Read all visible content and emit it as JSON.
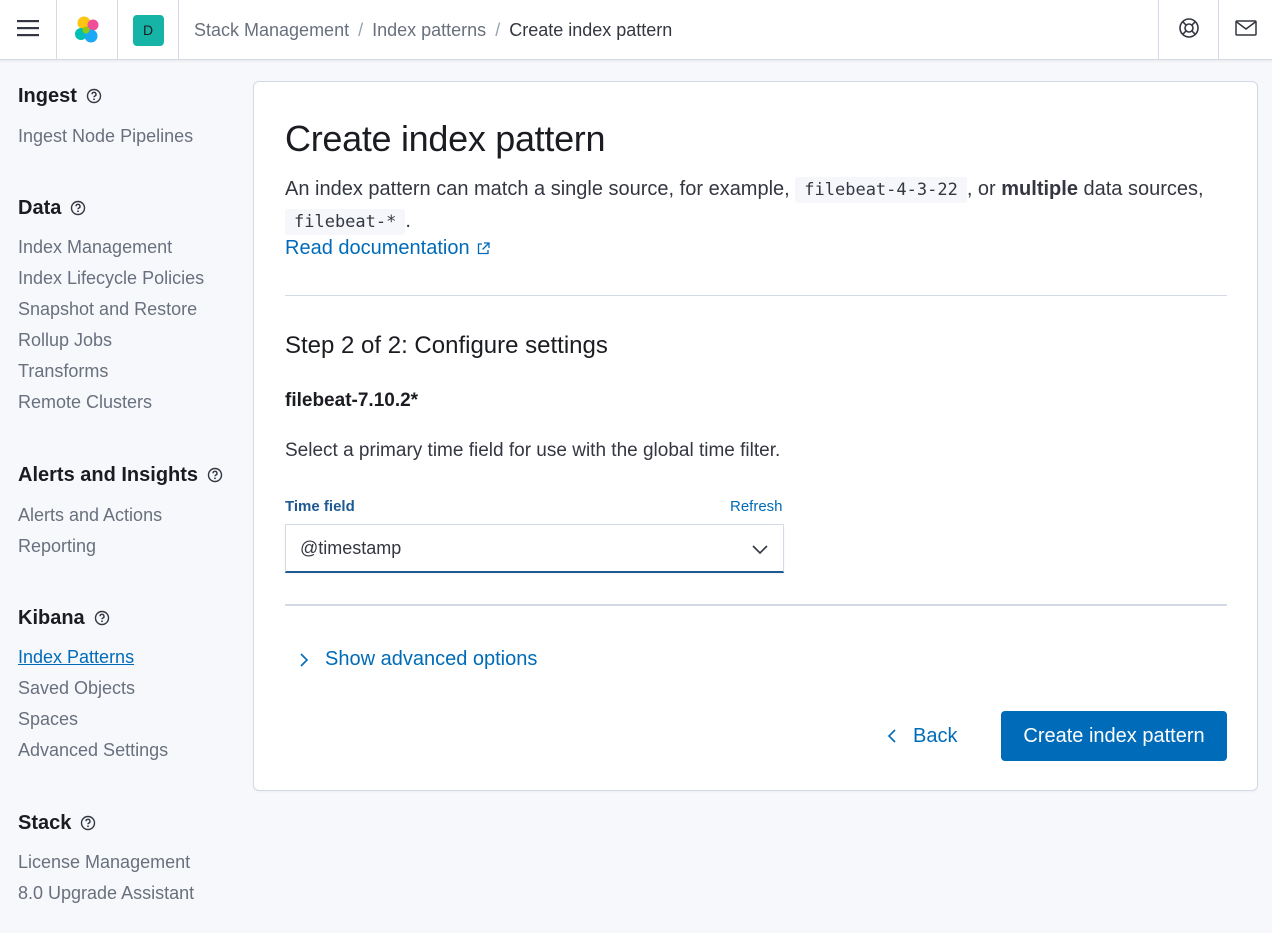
{
  "header": {
    "space_initial": "D",
    "breadcrumbs": [
      "Stack Management",
      "Index patterns",
      "Create index pattern"
    ]
  },
  "sidebar": {
    "groups": [
      {
        "title": "Ingest",
        "items": [
          "Ingest Node Pipelines"
        ]
      },
      {
        "title": "Data",
        "items": [
          "Index Management",
          "Index Lifecycle Policies",
          "Snapshot and Restore",
          "Rollup Jobs",
          "Transforms",
          "Remote Clusters"
        ]
      },
      {
        "title": "Alerts and Insights",
        "items": [
          "Alerts and Actions",
          "Reporting"
        ]
      },
      {
        "title": "Kibana",
        "items": [
          "Index Patterns",
          "Saved Objects",
          "Spaces",
          "Advanced Settings"
        ]
      },
      {
        "title": "Stack",
        "items": [
          "License Management",
          "8.0 Upgrade Assistant"
        ]
      }
    ],
    "active_item": "Index Patterns"
  },
  "main": {
    "title": "Create index pattern",
    "desc_part1": "An index pattern can match a single source, for example, ",
    "desc_code1": "filebeat-4-3-22",
    "desc_part2": ", or ",
    "desc_bold": "multiple",
    "desc_part3": " data sources, ",
    "desc_code2": "filebeat-*",
    "desc_part4": ".",
    "doc_link": "Read documentation",
    "step_title": "Step 2 of 2: Configure settings",
    "index_name": "filebeat-7.10.2*",
    "select_desc": "Select a primary time field for use with the global time filter.",
    "time_field_label": "Time field",
    "refresh_label": "Refresh",
    "time_field_value": "@timestamp",
    "advanced_label": "Show advanced options",
    "back_label": "Back",
    "create_label": "Create index pattern"
  },
  "colors": {
    "primary": "#006bb8",
    "space_avatar": "#15b4a6"
  }
}
